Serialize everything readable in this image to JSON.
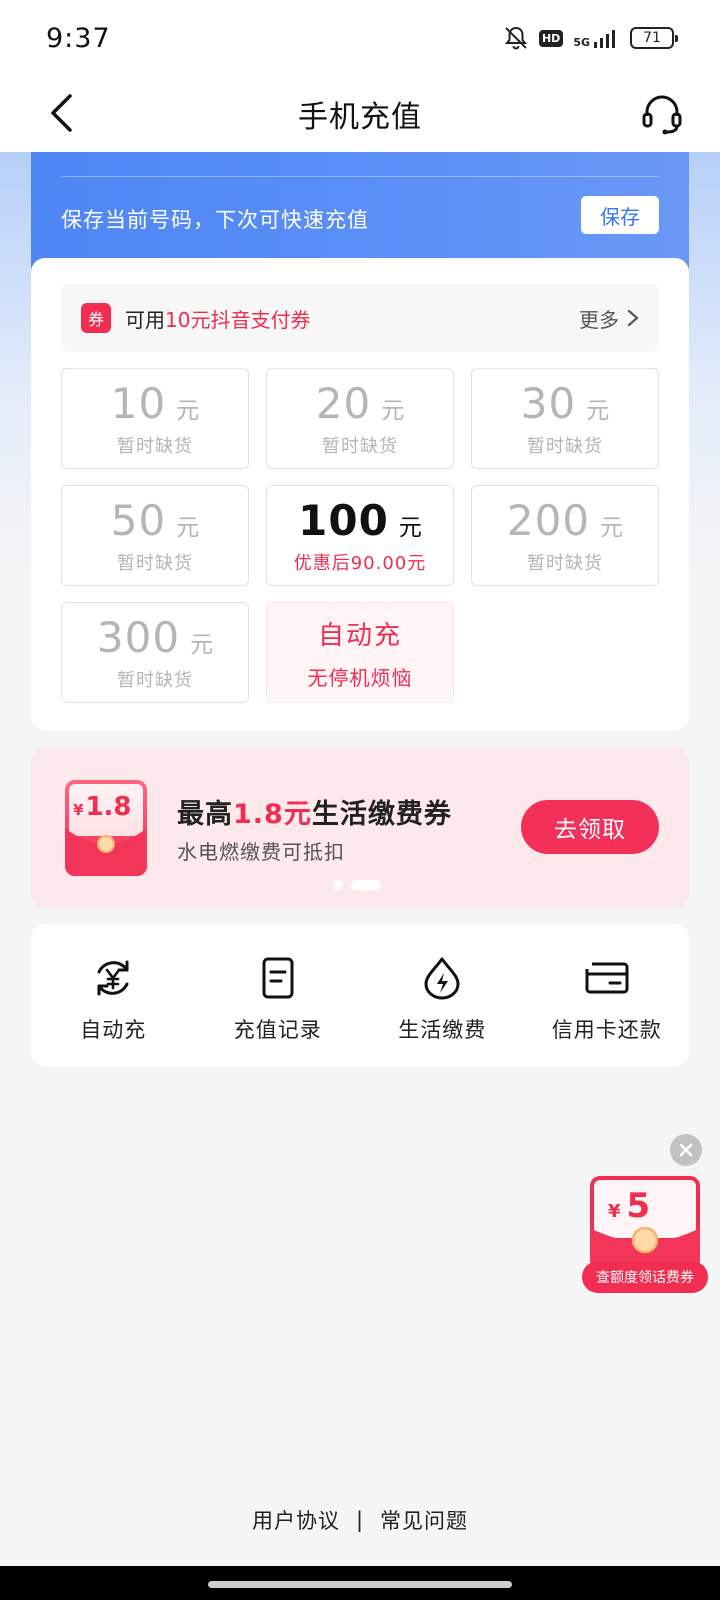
{
  "status_bar": {
    "time": "9:37",
    "hd_label": "HD",
    "network_label": "5G",
    "battery": "71",
    "icons": [
      "bell-muted-icon",
      "hd-icon",
      "signal-5g-icon",
      "battery-icon"
    ]
  },
  "nav": {
    "title": "手机充值",
    "back_icon": "chevron-left-icon",
    "service_icon": "headset-icon"
  },
  "save_bar": {
    "hint": "保存当前号码，下次可快速充值",
    "button": "保存"
  },
  "coupon": {
    "badge": "券",
    "prefix": "可用",
    "highlight": "10元抖音支付券",
    "more": "更多"
  },
  "amounts": [
    {
      "value": "10",
      "unit": "元",
      "sub": "暂时缺货",
      "state": "disabled"
    },
    {
      "value": "20",
      "unit": "元",
      "sub": "暂时缺货",
      "state": "disabled"
    },
    {
      "value": "30",
      "unit": "元",
      "sub": "暂时缺货",
      "state": "disabled"
    },
    {
      "value": "50",
      "unit": "元",
      "sub": "暂时缺货",
      "state": "disabled"
    },
    {
      "value": "100",
      "unit": "元",
      "sub": "优惠后90.00元",
      "state": "active"
    },
    {
      "value": "200",
      "unit": "元",
      "sub": "暂时缺货",
      "state": "disabled"
    },
    {
      "value": "300",
      "unit": "元",
      "sub": "暂时缺货",
      "state": "disabled"
    }
  ],
  "auto_tile": {
    "title": "自动充",
    "sub": "无停机烦恼"
  },
  "promo": {
    "envelope_amount": "1.8",
    "envelope_currency": "¥",
    "title_prefix": "最高",
    "title_highlight": "1.8元",
    "title_suffix": "生活缴费券",
    "subtitle": "水电燃缴费可抵扣",
    "button": "去领取",
    "pages": 2,
    "active_page": 2
  },
  "quick_actions": [
    {
      "label": "自动充",
      "icon": "yen-cycle-icon"
    },
    {
      "label": "充值记录",
      "icon": "document-icon"
    },
    {
      "label": "生活缴费",
      "icon": "lightning-drop-icon"
    },
    {
      "label": "信用卡还款",
      "icon": "credit-card-icon"
    }
  ],
  "float_coupon": {
    "currency": "¥",
    "amount": "5",
    "label": "查额度领话费券"
  },
  "footer": {
    "agreement": "用户协议",
    "separator": "|",
    "faq": "常见问题"
  },
  "colors": {
    "accent": "#f12d52",
    "blue": "#5189f5",
    "text": "#222222",
    "muted": "#b5b5b5"
  }
}
